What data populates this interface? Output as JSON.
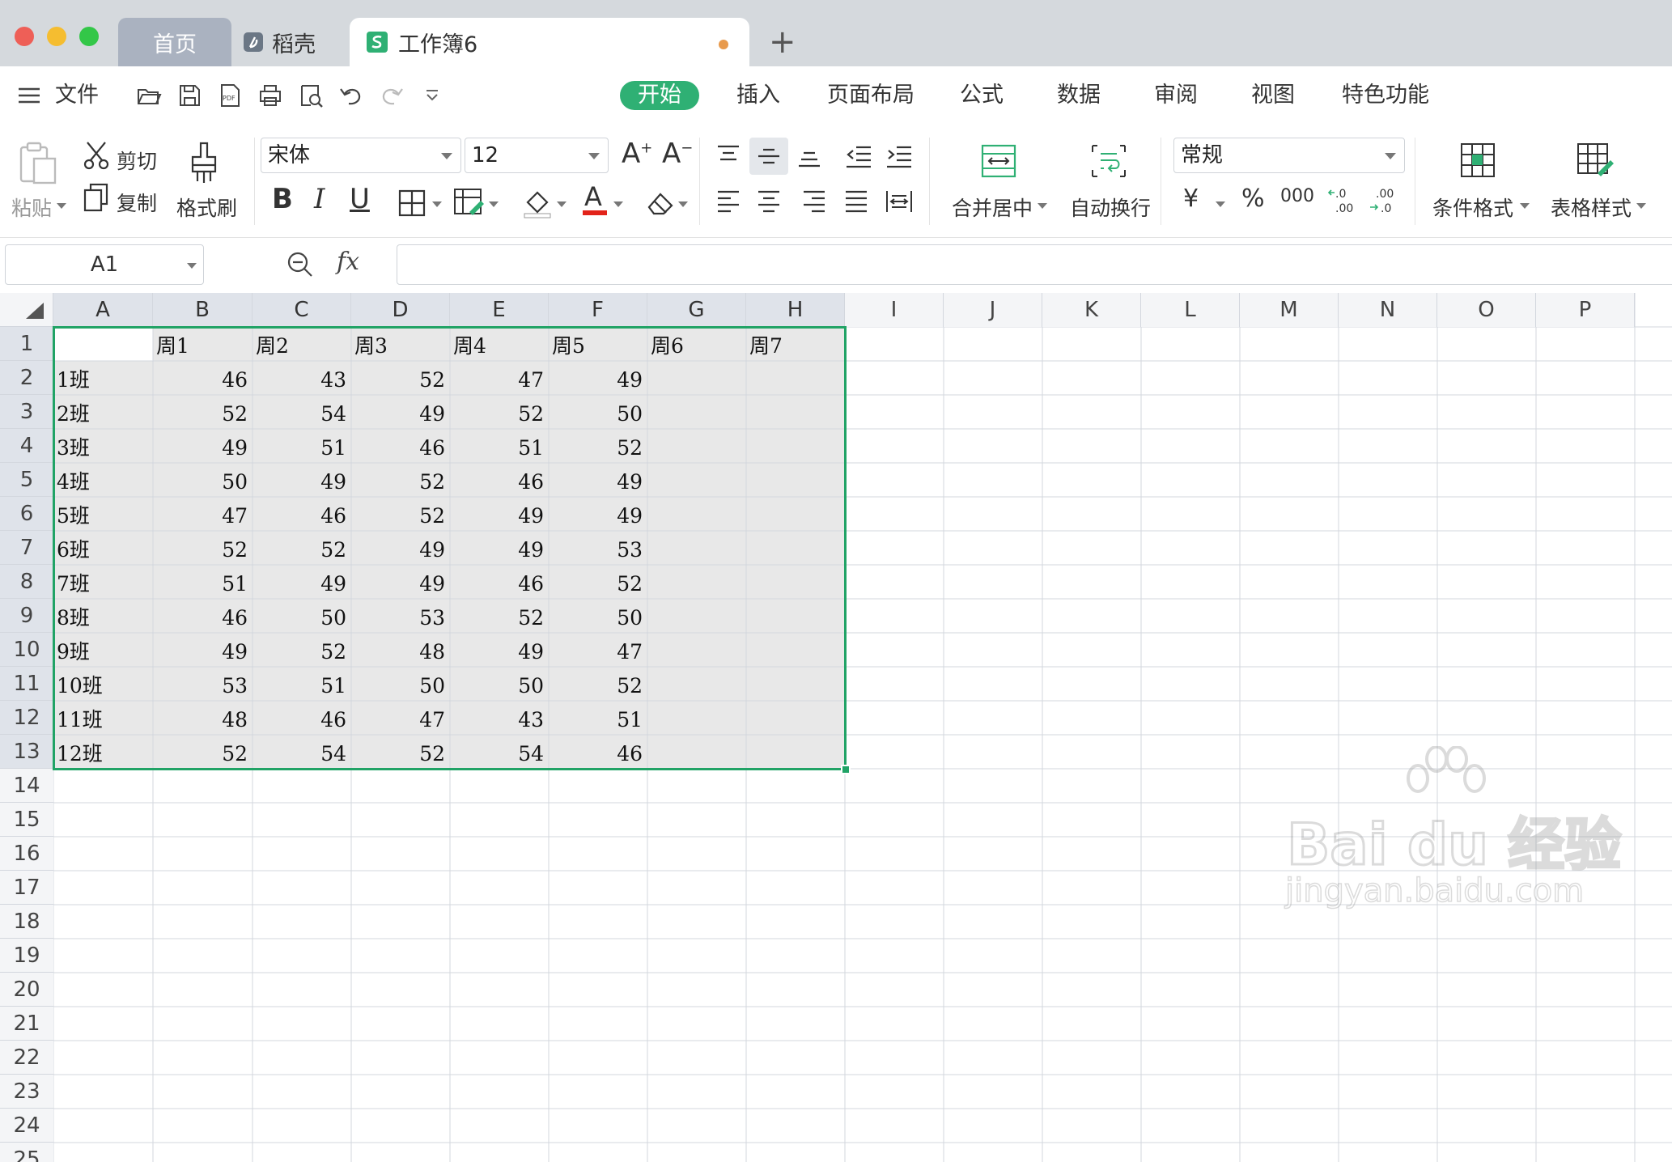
{
  "tabs": {
    "home": "首页",
    "daoke": "稻壳",
    "doc": "工作簿6"
  },
  "menu": {
    "file": "文件",
    "items": [
      "开始",
      "插入",
      "页面布局",
      "公式",
      "数据",
      "审阅",
      "视图",
      "特色功能"
    ]
  },
  "ribbon": {
    "paste": "粘贴",
    "cut": "剪切",
    "copy": "复制",
    "format_painter": "格式刷",
    "font_name": "宋体",
    "font_size": "12",
    "bold": "B",
    "italic": "I",
    "underline": "U",
    "merge_center": "合并居中",
    "wrap_text": "自动换行",
    "number_format": "常规",
    "currency": "¥",
    "percent": "%",
    "thousands": "000",
    "conditional_format": "条件格式",
    "table_style": "表格样式"
  },
  "formula_bar": {
    "name_box": "A1",
    "fx": "fx",
    "content": ""
  },
  "sheet": {
    "columns": [
      "A",
      "B",
      "C",
      "D",
      "E",
      "F",
      "G",
      "H",
      "I",
      "J",
      "K",
      "L",
      "M",
      "N",
      "O",
      "P"
    ],
    "row_count": 25,
    "header_row": [
      "",
      "周1",
      "周2",
      "周3",
      "周4",
      "周5",
      "周6",
      "周7"
    ],
    "rows": [
      [
        "1班",
        "46",
        "43",
        "52",
        "47",
        "49",
        "",
        ""
      ],
      [
        "2班",
        "52",
        "54",
        "49",
        "52",
        "50",
        "",
        ""
      ],
      [
        "3班",
        "49",
        "51",
        "46",
        "51",
        "52",
        "",
        ""
      ],
      [
        "4班",
        "50",
        "49",
        "52",
        "46",
        "49",
        "",
        ""
      ],
      [
        "5班",
        "47",
        "46",
        "52",
        "49",
        "49",
        "",
        ""
      ],
      [
        "6班",
        "52",
        "52",
        "49",
        "49",
        "53",
        "",
        ""
      ],
      [
        "7班",
        "51",
        "49",
        "49",
        "46",
        "52",
        "",
        ""
      ],
      [
        "8班",
        "46",
        "50",
        "53",
        "52",
        "50",
        "",
        ""
      ],
      [
        "9班",
        "49",
        "52",
        "48",
        "49",
        "47",
        "",
        ""
      ],
      [
        "10班",
        "53",
        "51",
        "50",
        "50",
        "52",
        "",
        ""
      ],
      [
        "11班",
        "48",
        "46",
        "47",
        "43",
        "51",
        "",
        ""
      ],
      [
        "12班",
        "52",
        "54",
        "52",
        "54",
        "46",
        "",
        ""
      ]
    ],
    "selection": "A1:H13"
  },
  "watermark": {
    "brand": "Bai du 经验",
    "url": "jingyan.baidu.com"
  },
  "colors": {
    "accent": "#2fb074",
    "selection_border": "#21a366",
    "selection_fill": "#e8e8e8",
    "gridline": "#d3d7de"
  }
}
